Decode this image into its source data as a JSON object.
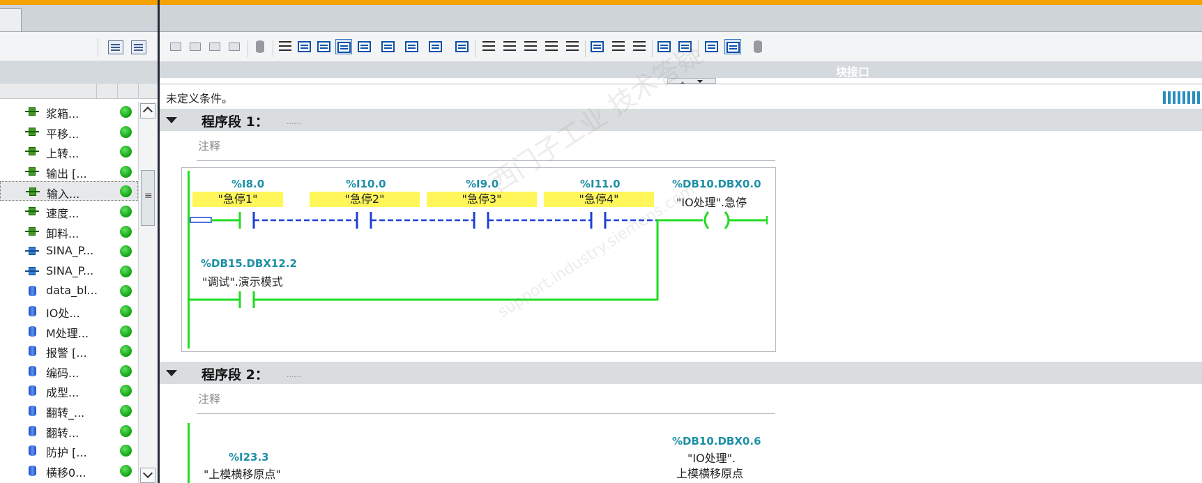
{
  "project_tree": {
    "items": [
      {
        "label": "浆箱...",
        "type": "fb"
      },
      {
        "label": "平移...",
        "type": "fb"
      },
      {
        "label": "上转...",
        "type": "fb"
      },
      {
        "label": "输出 [...",
        "type": "fb"
      },
      {
        "label": "输入...",
        "type": "fb",
        "selected": true
      },
      {
        "label": "速度...",
        "type": "fb"
      },
      {
        "label": "卸料...",
        "type": "fb"
      },
      {
        "label": "SINA_P...",
        "type": "fb-blue"
      },
      {
        "label": "SINA_P...",
        "type": "fb-blue"
      },
      {
        "label": "data_bl...",
        "type": "db"
      },
      {
        "label": "IO处...",
        "type": "db"
      },
      {
        "label": "M处理...",
        "type": "db"
      },
      {
        "label": "报警 [...",
        "type": "db"
      },
      {
        "label": "编码...",
        "type": "db"
      },
      {
        "label": "成型...",
        "type": "db"
      },
      {
        "label": "翻转_...",
        "type": "db"
      },
      {
        "label": "翻转...",
        "type": "db"
      },
      {
        "label": "防护 [...",
        "type": "db"
      },
      {
        "label": "横移0...",
        "type": "db"
      }
    ],
    "status_color": "#10a010"
  },
  "editor": {
    "interface_title": "块接口",
    "condition_text": "未定义条件。",
    "networks": [
      {
        "title": "程序段 1：",
        "title_value": "......",
        "comment": "注释",
        "contacts": [
          {
            "addr": "%I8.0",
            "name": "\"急停1\""
          },
          {
            "addr": "%I10.0",
            "name": "\"急停2\""
          },
          {
            "addr": "%I9.0",
            "name": "\"急停3\""
          },
          {
            "addr": "%I11.0",
            "name": "\"急停4\""
          }
        ],
        "coil": {
          "addr": "%DB10.DBX0.0",
          "name": "\"IO处理\".急停"
        },
        "branch_contact": {
          "addr": "%DB15.DBX12.2",
          "name": "\"调试\".演示模式"
        }
      },
      {
        "title": "程序段 2：",
        "title_value": "......",
        "comment": "注释",
        "contact": {
          "addr": "%I23.3",
          "name": "\"上模横移原点\""
        },
        "coil": {
          "addr": "%DB10.DBX0.6",
          "name_line1": "\"IO处理\".",
          "name_line2": "上模横移原点"
        }
      }
    ],
    "watermark_line1": "西门子工业 技术答疑",
    "watermark_line2": "support.industry.siemens.com"
  },
  "colors": {
    "accent_orange": "#f5a100",
    "rung_green": "#1fdc1f",
    "rung_blue_dashed": "#1b3fd6",
    "address_teal": "#1d8fa6",
    "tag_highlight": "#fff65a"
  }
}
